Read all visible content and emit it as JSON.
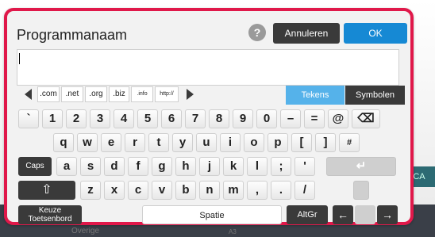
{
  "dialog": {
    "title": "Programmanaam",
    "help": "?",
    "cancel_label": "Annuleren",
    "ok_label": "OK",
    "input_value": ""
  },
  "domains": [
    ".com",
    ".net",
    ".org",
    ".biz",
    ".info",
    "http://"
  ],
  "tabs": {
    "tekens": "Tekens",
    "symbolen": "Symbolen"
  },
  "rows": {
    "row1": [
      "`",
      "1",
      "2",
      "3",
      "4",
      "5",
      "6",
      "7",
      "8",
      "9",
      "0",
      "–",
      "=",
      "@"
    ],
    "row2": [
      "q",
      "w",
      "e",
      "r",
      "t",
      "y",
      "u",
      "i",
      "o",
      "p",
      "[",
      "]",
      "#"
    ],
    "row3": [
      "a",
      "s",
      "d",
      "f",
      "g",
      "h",
      "j",
      "k",
      "l",
      ";",
      "'"
    ],
    "row4": [
      "z",
      "x",
      "c",
      "v",
      "b",
      "n",
      "m",
      ",",
      ".",
      "/"
    ]
  },
  "keys": {
    "backspace": "⌫",
    "caps": "Caps",
    "shift": "⇧",
    "enter": "↵",
    "keyboard_select": "Keuze Toetsenbord",
    "space": "Spatie",
    "altgr": "AltGr",
    "left": "←",
    "right": "→"
  },
  "background": {
    "left_text": "Overige",
    "bottom_text": "A3",
    "right_text": "CA"
  },
  "colors": {
    "accent_border": "#e0184a",
    "ok_blue": "#1689d4",
    "tekens_blue": "#55b2ea",
    "dark_key": "#3a3a3a"
  }
}
